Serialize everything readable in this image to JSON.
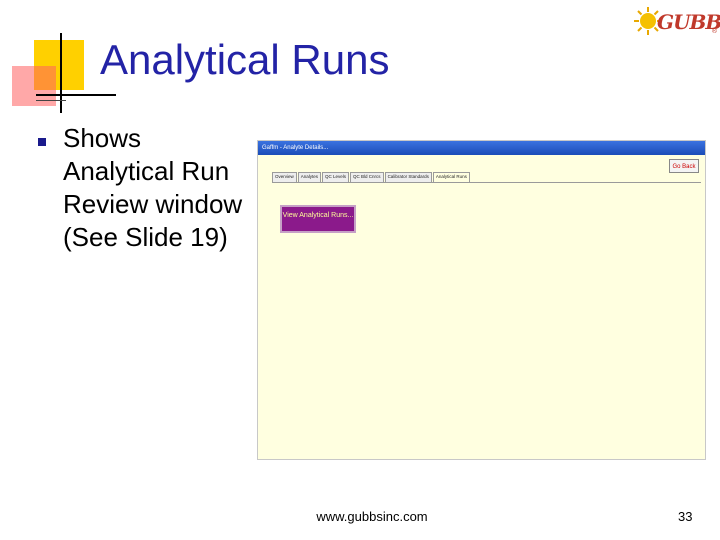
{
  "slide": {
    "title": "Analytical Runs",
    "bullets": [
      "Shows Analytical Run Review window (See Slide 19)"
    ],
    "footer_url": "www.gubbsinc.com",
    "page_number": "33"
  },
  "logo": {
    "text": "GUBBS",
    "mark": "®"
  },
  "screenshot": {
    "window_title": "Gaffm - Analyte Details...",
    "go_back_label": "Go Back",
    "tabs": [
      "Overview",
      "Analytes",
      "QC Levels",
      "QC Bld Cnrcs",
      "Calibrator Standards",
      "Analytical Runs"
    ],
    "active_tab": "Analytical Runs",
    "view_button_label": "View Analytical Runs..."
  },
  "colors": {
    "title": "#2323a6",
    "accent_yellow": "#ffd000",
    "accent_pink": "#ff6060",
    "view_button": "#8b1a8b",
    "panel_bg": "#ffffe0"
  }
}
